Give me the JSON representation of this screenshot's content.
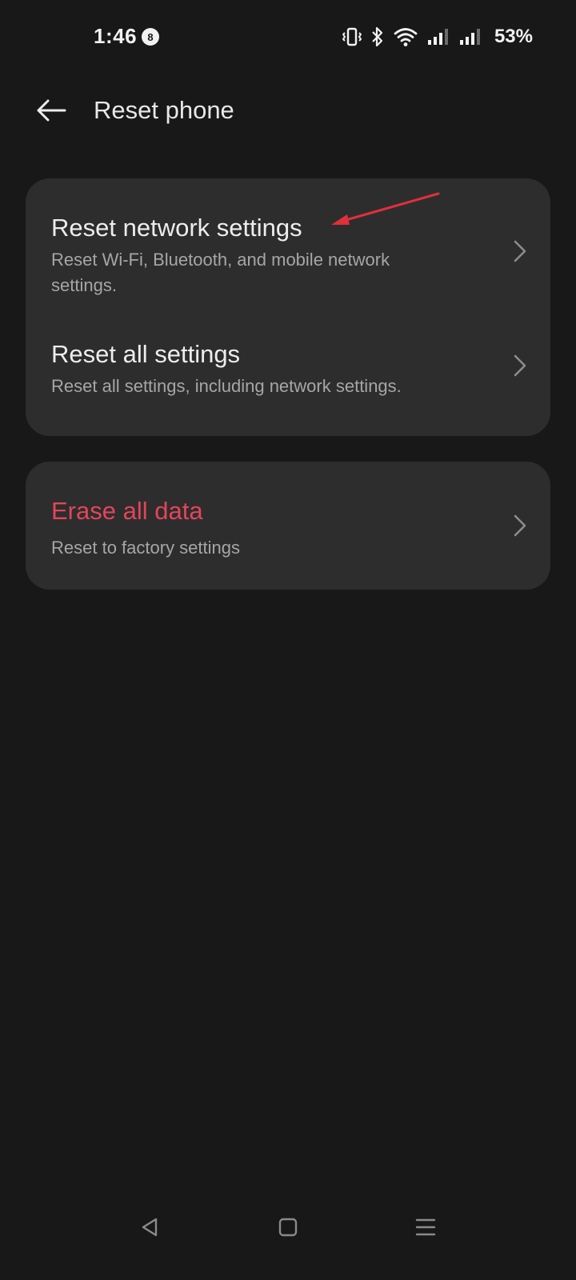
{
  "status_bar": {
    "time": "1:46",
    "notification_count": "8",
    "battery": "53%",
    "icons": [
      "vibrate-icon",
      "bluetooth-icon",
      "wifi-icon",
      "signal-icon",
      "signal-icon"
    ]
  },
  "header": {
    "title": "Reset phone",
    "back_icon": "arrow-left-icon"
  },
  "options": {
    "network": {
      "title": "Reset network settings",
      "subtitle": "Reset Wi-Fi, Bluetooth, and mobile network settings."
    },
    "all_settings": {
      "title": "Reset all settings",
      "subtitle": "Reset all settings, including network settings."
    },
    "erase": {
      "title": "Erase all data",
      "subtitle": "Reset to factory settings"
    }
  },
  "nav_bar": {
    "icons": [
      "back-triangle-icon",
      "home-square-icon",
      "recents-menu-icon"
    ]
  },
  "colors": {
    "background": "#181818",
    "card": "#2d2d2d",
    "danger": "#e2455a",
    "annotation_arrow": "#e0303c"
  }
}
